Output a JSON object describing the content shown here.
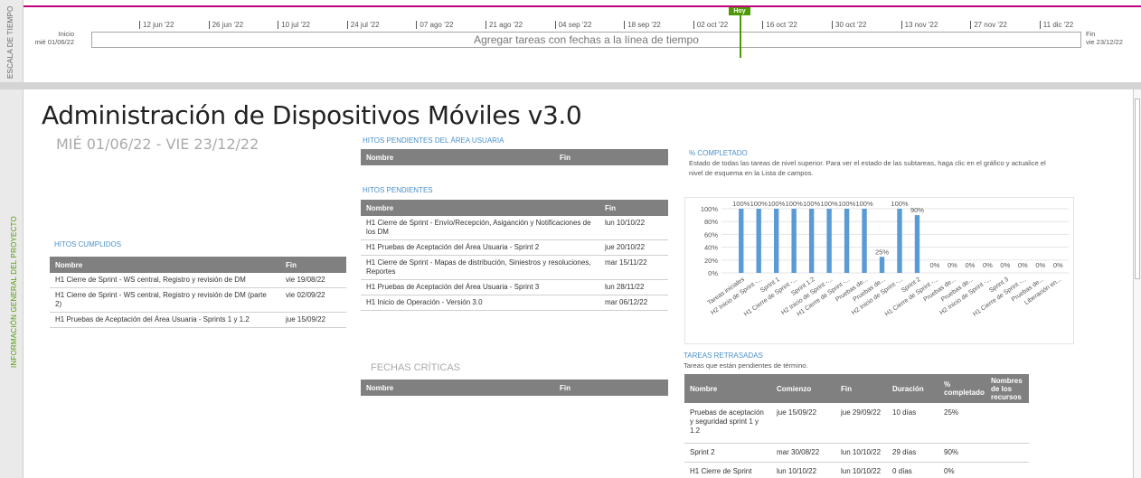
{
  "timeline": {
    "side_label": "ESCALA DE TIEMPO",
    "start_label": "Inicio",
    "start_date": "mié 01/06/22",
    "end_label": "Fin",
    "end_date": "vie 23/12/22",
    "placeholder": "Agregar tareas con fechas a la línea de tiempo",
    "today_label": "Hoy",
    "ticks": [
      "12 jun '22",
      "26 jun '22",
      "10 jul '22",
      "24 jul '22",
      "07 ago '22",
      "21 ago '22",
      "04 sep '22",
      "18 sep '22",
      "02 oct '22",
      "16 oct '22",
      "30 oct '22",
      "13 nov '22",
      "27 nov '22",
      "11 dic '22"
    ]
  },
  "side_label": "INFORMACIÓN GENERAL DEL PROYECTO",
  "report": {
    "title": "Administración de Dispositivos Móviles v3.0",
    "dates": "MIÉ 01/06/22  -  VIE 23/12/22"
  },
  "hitos_cumplidos": {
    "title": "HITOS CUMPLIDOS",
    "col_name": "Nombre",
    "col_end": "Fin",
    "rows": [
      {
        "name": "H1 Cierre de Sprint - WS central, Registro y revisión de DM",
        "end": "vie 19/08/22"
      },
      {
        "name": "H1 Cierre de Sprint - WS central, Registro y revisión de DM (parte 2)",
        "end": "vie 02/09/22"
      },
      {
        "name": "H1 Pruebas de Aceptación del Área Usuaria - Sprints 1 y 1.2",
        "end": "jue 15/09/22"
      }
    ]
  },
  "hitos_area_usuaria": {
    "title": "HITOS PENDIENTES DEL ÁREA USUARIA",
    "col_name": "Nombre",
    "col_end": "Fin"
  },
  "hitos_pendientes": {
    "title": "HITOS PENDIENTES",
    "col_name": "Nombre",
    "col_end": "Fin",
    "rows": [
      {
        "name": "H1 Cierre de Sprint - Envío/Recepción, Asiganción y Notificaciones de los DM",
        "end": "lun 10/10/22"
      },
      {
        "name": "H1 Pruebas de Aceptación del Área Usuaria - Sprint 2",
        "end": "jue 20/10/22"
      },
      {
        "name": "H1 Cierre de Sprint - Mapas de distribución, Siniestros y resoluciones, Reportes",
        "end": "mar 15/11/22"
      },
      {
        "name": "H1 Pruebas de Aceptación del Área Usuaria - Sprint 3",
        "end": "lun 28/11/22"
      },
      {
        "name": "H1 Inicio de Operación - Versión 3.0",
        "end": "mar 06/12/22"
      }
    ]
  },
  "fechas_criticas": {
    "title": "FECHAS CRÍTICAS",
    "col_name": "Nombre",
    "col_end": "Fin"
  },
  "completado": {
    "title": "% COMPLETADO",
    "description": "Estado de todas las tareas de nivel superior. Para ver el estado de las subtareas, haga clic en el gráfico y actualice el nivel de esquema en la Lista de campos."
  },
  "chart_data": {
    "type": "bar",
    "color": "#5b9bd5",
    "ylim": [
      0,
      100
    ],
    "yticks": [
      "0%",
      "20%",
      "40%",
      "60%",
      "80%",
      "100%"
    ],
    "categories": [
      "Tareas iniciales",
      "H2 Inicio de Sprint -...",
      "Sprint 1",
      "H1 Cierre de Sprint -...",
      "Sprint 1.2",
      "H2 Inicio de Sprint -...",
      "H1 Cierre de Sprint -...",
      "Pruebas de...",
      "Pruebas de...",
      "H2 Inicio de Sprint -...",
      "Sprint 2",
      "H1 Cierre de Sprint -...",
      "Pruebas de...",
      "Pruebas de...",
      "H2 Inicio de Sprint -...",
      "Sprint 3",
      "H1 Cierre de Sprint -...",
      "Pruebas de...",
      "Liberación en..."
    ],
    "values": [
      100,
      100,
      100,
      100,
      100,
      100,
      100,
      100,
      25,
      100,
      90,
      0,
      0,
      0,
      0,
      0,
      0,
      0,
      0
    ],
    "data_labels": [
      "100%",
      "100%",
      "100%",
      "100%",
      "100%",
      "100%",
      "100%",
      "100%",
      "25%",
      "100%",
      "90%",
      "0%",
      "0%",
      "0%",
      "0%",
      "0%",
      "0%",
      "0%",
      "0%"
    ]
  },
  "tareas_retrasadas": {
    "title": "TAREAS RETRASADAS",
    "subtitle": "Tareas que están pendientes de término.",
    "columns": [
      "Nombre",
      "Comienzo",
      "Fin",
      "Duración",
      "% completado",
      "Nombres de los recursos"
    ],
    "rows": [
      {
        "name": "Pruebas de aceptación y seguridad sprint 1 y 1.2",
        "start": "jue 15/09/22",
        "end": "jue 29/09/22",
        "duration": "10 días",
        "pct": "25%",
        "resources": ""
      },
      {
        "name": "Sprint 2",
        "start": "mar 30/08/22",
        "end": "lun 10/10/22",
        "duration": "29 días",
        "pct": "90%",
        "resources": ""
      },
      {
        "name": "H1 Cierre de Sprint",
        "start": "lun 10/10/22",
        "end": "lun 10/10/22",
        "duration": "0 días",
        "pct": "0%",
        "resources": ""
      }
    ]
  }
}
